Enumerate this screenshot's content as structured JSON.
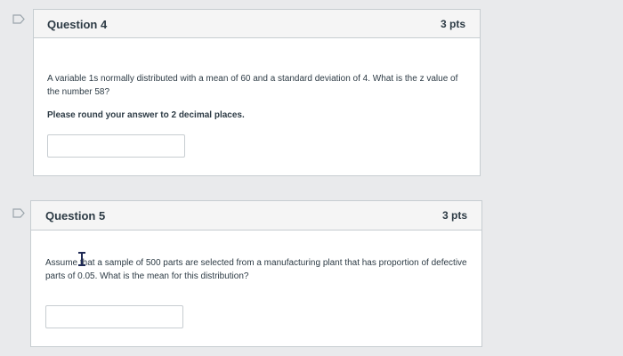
{
  "questions": [
    {
      "title": "Question 4",
      "points": "3 pts",
      "text": "A variable 1s normally distributed with a mean of 60 and a standard deviation of 4.  What is the z value of the number 58?",
      "note": "Please round your answer to 2 decimal places.",
      "answer_value": ""
    },
    {
      "title": "Question 5",
      "points": "3 pts",
      "text": "Assume that a sample of 500 parts are selected from a manufacturing plant that has proportion of defective parts of 0.05.  What is the mean for this distribution?",
      "answer_value": ""
    }
  ],
  "icons": {
    "bookmark": "bookmark-flag-icon",
    "cursor": "text-cursor-icon"
  },
  "colors": {
    "header_bg": "#f5f5f5",
    "border": "#c7cdd1",
    "text": "#2d3b45",
    "page_bg": "#e9eaec",
    "bookmark": "#9aa4ab",
    "cursor": "#1f2a55"
  }
}
